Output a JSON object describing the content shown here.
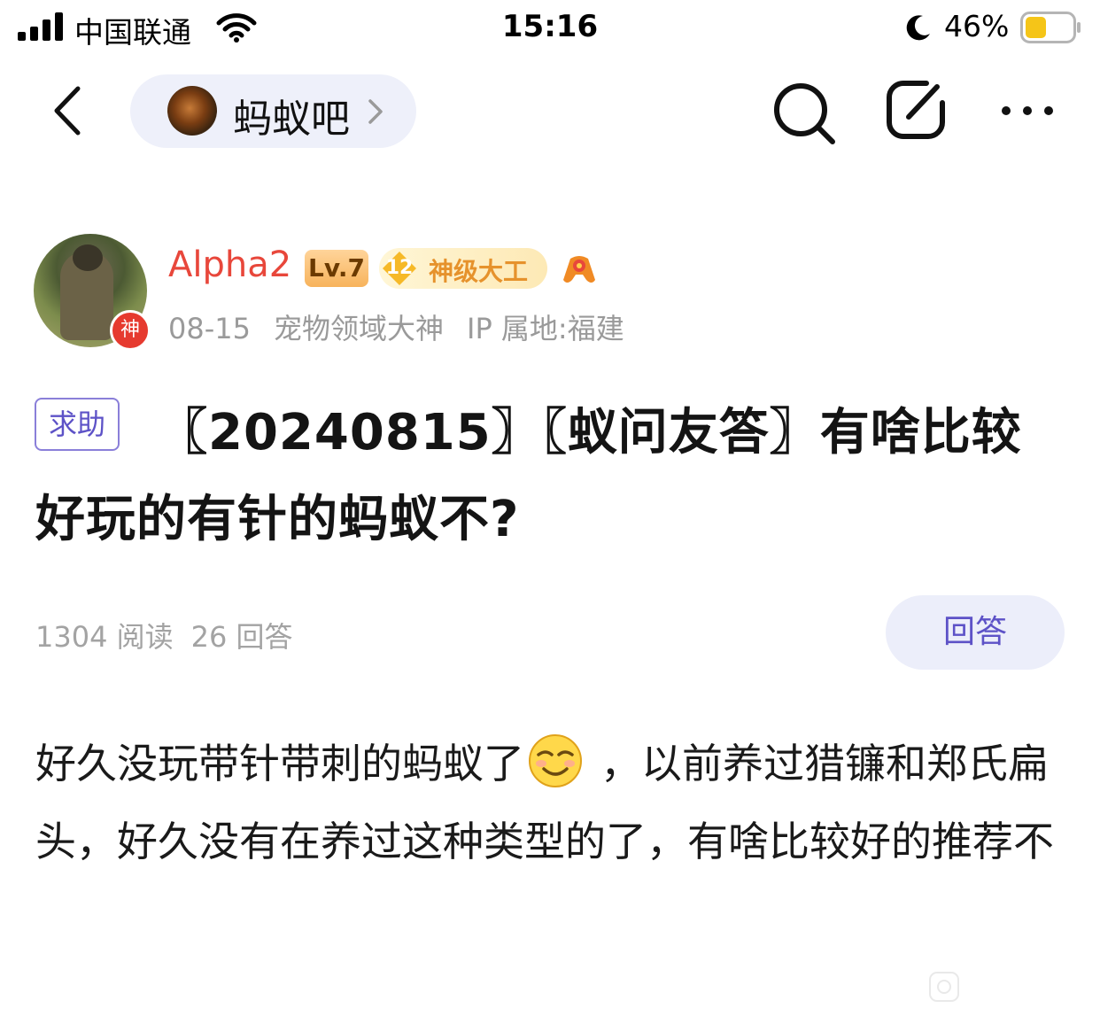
{
  "status_bar": {
    "carrier": "中国联通",
    "time": "15:16",
    "battery_percent": "46%",
    "battery_level": 0.46,
    "battery_color": "#f5c518"
  },
  "nav": {
    "forum_name": "蚂蚁吧",
    "icons": [
      "back-icon",
      "search-icon",
      "edit-icon",
      "more-icon"
    ]
  },
  "author": {
    "name": "Alpha2",
    "level": "Lv.7",
    "rank_number": "12",
    "rank_title": "神级大工",
    "avatar_badge": "神",
    "date": "08-15",
    "honor": "宠物领域大神",
    "ip_location": "IP 属地:福建",
    "name_color": "#e8473b"
  },
  "post": {
    "tag": "求助",
    "title": "〖20240815〗〖蚁问友答〗有啥比较好玩的有针的蚂蚁不?",
    "reads": "1304 阅读",
    "answers": "26 回答",
    "reply_label": "回答",
    "body_part1": "好久没玩带针带刺的蚂蚁了",
    "body_part2": "，以前养过猎镰和郑氏扁头，好久没有在养过这种类型的了，有啥比较好的推荐不",
    "accent_color": "#5d52c7"
  }
}
